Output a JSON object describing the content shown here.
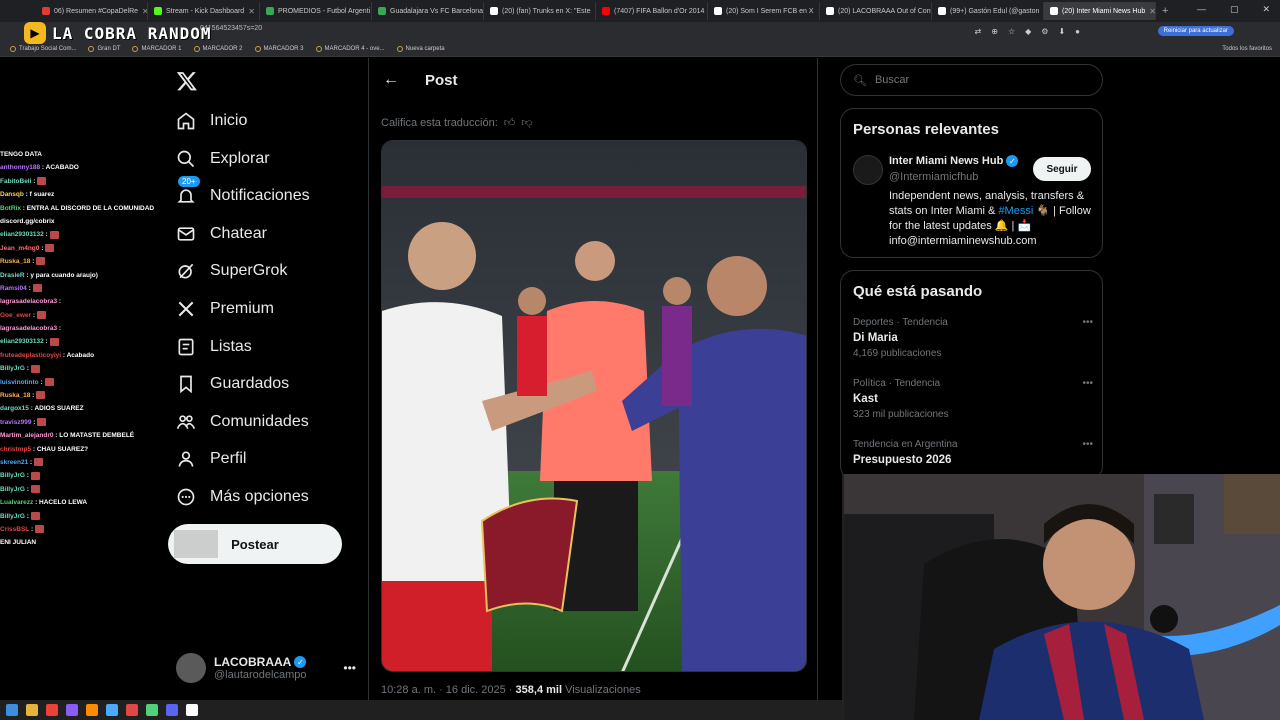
{
  "browser": {
    "tabs": [
      {
        "label": "06) Resumen #CopaDelRe",
        "color": "#e53935"
      },
      {
        "label": "Stream - Kick Dashboard",
        "color": "#53fc18"
      },
      {
        "label": "PROMEDIOS - Futbol Argenti",
        "color": "#34a853"
      },
      {
        "label": "Guadalajara Vs FC Barcelona",
        "color": "#34a853"
      },
      {
        "label": "(20) (fan) Trunks en X: \"Este",
        "color": "#ffffff"
      },
      {
        "label": "(7407) FIFA Ballon d'Or 2014",
        "color": "#ff0000"
      },
      {
        "label": "(20) Som I Serem FCB en X",
        "color": "#ffffff"
      },
      {
        "label": "(20) LACOBRAAA Out of Cont",
        "color": "#ffffff"
      },
      {
        "label": "(99+) Gastón Edul (@gaston",
        "color": "#ffffff"
      },
      {
        "label": "(20) Inter Miami News Hub",
        "color": "#ffffff"
      }
    ],
    "url": "041564523457s=20",
    "update_label": "Reiniciar para actualizar",
    "bookmarks": [
      "Trabajo Social Com...",
      "Gran DT",
      "MARCADOR 1",
      "MARCADOR 2",
      "MARCADOR 3",
      "MARCADOR 4 - ove...",
      "Nueva carpeta"
    ],
    "all_favorites": "Todos los favoritos"
  },
  "overlay": {
    "logo_text": "LA COBRA RANDOM"
  },
  "chat": [
    {
      "user": "TENGO DATA",
      "text": "",
      "color": "#ffffff",
      "emote": false
    },
    {
      "user": "anthonny188",
      "text": ": ACABADO",
      "color": "#b675ff",
      "emote": false
    },
    {
      "user": "FabitoBeli",
      "text": ":",
      "color": "#6ddcc1",
      "emote": true
    },
    {
      "user": "Dansqb",
      "text": ": f suarez",
      "color": "#ffd24a",
      "emote": false
    },
    {
      "user": "BotRix",
      "text": ": ENTRA AL DISCORD DE LA COMUNIDAD",
      "color": "#52d17a",
      "emote": false
    },
    {
      "user": "discord.gg/cobrix",
      "text": "",
      "color": "#ffffff",
      "emote": false
    },
    {
      "user": "elian29303132",
      "text": ":",
      "color": "#6ddcc1",
      "emote": true
    },
    {
      "user": "Jean_m4ng0",
      "text": ":",
      "color": "#ff6e6e",
      "emote": true
    },
    {
      "user": "Ruska_18",
      "text": ":",
      "color": "#ffb347",
      "emote": true
    },
    {
      "user": "DrasieR",
      "text": ": y para cuando araujo)",
      "color": "#6ddcc1",
      "emote": false
    },
    {
      "user": "Ramsi04",
      "text": ":",
      "color": "#b675ff",
      "emote": true
    },
    {
      "user": "lagrasadelacobra3",
      "text": ":",
      "color": "#ff9ad5",
      "emote": false
    },
    {
      "user": "Goe_ewer",
      "text": ":",
      "color": "#e04848",
      "emote": true
    },
    {
      "user": "lagrasadelacobra3",
      "text": ":",
      "color": "#ff9ad5",
      "emote": false
    },
    {
      "user": "elian29303132",
      "text": ":",
      "color": "#6ddcc1",
      "emote": true
    },
    {
      "user": "fruteadeplasticoyiyi",
      "text": ": Acabado",
      "color": "#e04848",
      "emote": false
    },
    {
      "user": "BillyJrG",
      "text": ":",
      "color": "#6ddcc1",
      "emote": true
    },
    {
      "user": "luisvinotinto",
      "text": ":",
      "color": "#4aa8ff",
      "emote": true
    },
    {
      "user": "Ruska_18",
      "text": ":",
      "color": "#ffb347",
      "emote": true
    },
    {
      "user": "dargox15",
      "text": ": ADIOS SUAREZ",
      "color": "#6ddcc1",
      "emote": false
    },
    {
      "user": "travisz999",
      "text": ":",
      "color": "#b675ff",
      "emote": true
    },
    {
      "user": "Martim_alejandr0",
      "text": ": LO MATASTE DEMBELÉ",
      "color": "#ff9ad5",
      "emote": false
    },
    {
      "user": "christmp5",
      "text": ": CHAU SUAREZ?",
      "color": "#e04848",
      "emote": false
    },
    {
      "user": "skreen21",
      "text": ":",
      "color": "#4aa8ff",
      "emote": true
    },
    {
      "user": "BillyJrG",
      "text": ":",
      "color": "#6ddcc1",
      "emote": true
    },
    {
      "user": "BillyJrG",
      "text": ":",
      "color": "#6ddcc1",
      "emote": true
    },
    {
      "user": "Lualvarezz",
      "text": ": HACELO LEWA",
      "color": "#52d17a",
      "emote": false
    },
    {
      "user": "BillyJrG",
      "text": ":",
      "color": "#6ddcc1",
      "emote": true
    },
    {
      "user": "CrissBSL",
      "text": ":",
      "color": "#e04848",
      "emote": true
    },
    {
      "user": "ENI JULIAN",
      "text": "",
      "color": "#ffffff",
      "emote": false
    }
  ],
  "nav": {
    "items": [
      {
        "label": "Inicio",
        "icon": "home-icon"
      },
      {
        "label": "Explorar",
        "icon": "search-icon"
      },
      {
        "label": "Notificaciones",
        "icon": "bell-icon"
      },
      {
        "label": "Chatear",
        "icon": "mail-icon"
      },
      {
        "label": "SuperGrok",
        "icon": "grok-icon"
      },
      {
        "label": "Premium",
        "icon": "x-premium-icon"
      },
      {
        "label": "Listas",
        "icon": "list-icon"
      },
      {
        "label": "Guardados",
        "icon": "bookmark-icon"
      },
      {
        "label": "Comunidades",
        "icon": "communities-icon"
      },
      {
        "label": "Perfil",
        "icon": "person-icon"
      },
      {
        "label": "Más opciones",
        "icon": "more-circle-icon"
      }
    ],
    "notif_badge": "20+",
    "post_button": "Postear",
    "account_name": "LACOBRAAA",
    "account_handle": "@lautarodelcampo"
  },
  "post": {
    "header": "Post",
    "rate_label": "Califica esta traducción:",
    "meta_time": "10:28 a. m. · 16 dic. 2025 ·",
    "meta_views": "358,4 mil",
    "meta_views_label": "Visualizaciones"
  },
  "sidebar": {
    "search_placeholder": "Buscar",
    "relevant_title": "Personas relevantes",
    "relevant": {
      "name": "Inter Miami News Hub",
      "handle": "@Intermiamicfhub",
      "follow": "Seguir",
      "bio_start": "Independent news, analysis, transfers & stats on Inter Miami & ",
      "bio_hashtag": "#Messi",
      "bio_end": " 🐐 | Follow for the latest updates 🔔 | 📩 info@intermiaminewshub.com"
    },
    "trending_title": "Qué está pasando",
    "trends": [
      {
        "meta": "Deportes · Tendencia",
        "name": "Di Maria",
        "count": "4,169 publicaciones"
      },
      {
        "meta": "Política · Tendencia",
        "name": "Kast",
        "count": "323 mil publicaciones"
      },
      {
        "meta": "Tendencia en Argentina",
        "name": "Presupuesto 2026",
        "count": ""
      }
    ]
  },
  "colors": {
    "accent": "#1d9bf0",
    "background": "#000000",
    "border": "#2f3336"
  }
}
